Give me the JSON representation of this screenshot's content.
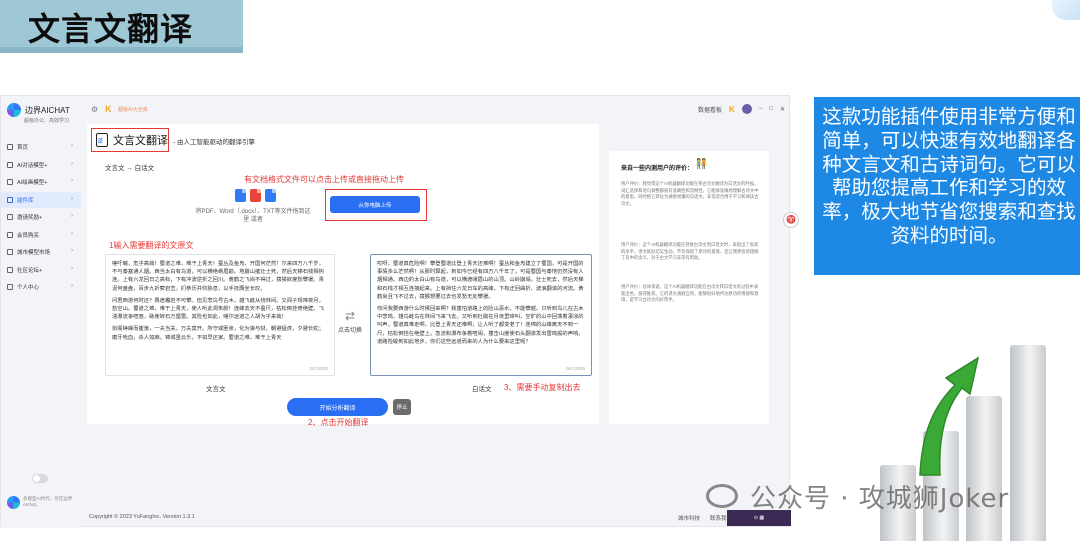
{
  "slide": {
    "title": "文言文翻译",
    "callout": "这款功能插件使用非常方便和简单，可以快速有效地翻译各种文言文和古诗词句。它可以帮助您提高工作和学习的效率，极大地节省您搜索和查找资料的时间。",
    "watermark": "公众号 · 攻城狮Joker"
  },
  "app": {
    "brand_name": "边界AICHAT",
    "brand_sub": "超级办公、高效学习",
    "topbar_brand": "超级AI大全库",
    "topbar_right_link": "数据看板",
    "sidebar": {
      "items": [
        {
          "label": "首页",
          "active": false
        },
        {
          "label": "AI对话模型+",
          "active": false
        },
        {
          "label": "AI绘画模型+",
          "active": false
        },
        {
          "label": "插件库",
          "active": true
        },
        {
          "label": "邀请奖励+",
          "active": false
        },
        {
          "label": "会员购买",
          "active": false
        },
        {
          "label": "城市模型市场",
          "active": false
        },
        {
          "label": "社区论坛+",
          "active": false
        },
        {
          "label": "个人中心",
          "active": false
        }
      ],
      "footer_text": "多模型AI时代，尽在边界AIchat。"
    },
    "module": {
      "title": "文言文翻译",
      "subtitle": "- 由人工智能驱动的翻译引擎",
      "direction": "文言文 → 白话文",
      "upload_hint": "有文档格式文件可以点击上传或直接拖动上传",
      "upload_desc": "将PDF、Word（.docx）、TXT等文件拖到这里 或者",
      "upload_button": "从你电脑上传",
      "input_hint": "1输入需要翻译的文原文",
      "source_paragraphs": [
        "嗟吁嘁，危乎高哉！蜀道之难，难于上青天！蚕丛及鱼凫，开国何茫然！尔来四万八千岁，不与秦塞通人烟。西当太白有鸟道，可以横绝峨眉巅。地崩山摧壮士死，然后天梯石栈相钩连。上有六龙回日之高标，下有冲波逆折之回川。黄鹤之飞尚不得过，猿猱欲度愁攀援。青泥何盘盘，百步九折萦岩峦。扪参历井仰胁息，以手抚膺坐长叹。",
        "问君西游何时还？畏途巉岩不可攀。但见悲鸟号古木，雄飞雌从绕林间。又闻子规啼夜月，愁空山。蜀道之难，难于上青天，使人听此凋朱颜！连峰去天不盈尺，枯松倒挂倚绝壁。飞湍瀑流争喧豗，砯崖转石万壑雷。其险也如此，嗟尔远道之人胡为乎来哉！",
        "剑阁峥嵘而崔嵬，一夫当关，万夫莫开。所守或匪亲，化为狼与豺。朝避猛虎，夕避长蛇；磨牙吮血，杀人如麻。锦城虽云乐，不如早还家。蜀道之难，难于上青天"
      ],
      "source_count": "347/2000",
      "swap_label": "点击切换",
      "target_paragraphs": [
        "哎呀，蜀道真危险啊！攀登蜀道比登上青天还难啊！蚕丛和鱼凫建立了蜀国，可是开国的事情多么茫然啊！从那时算起，到如今已经有四万八千年了，可是蜀国与秦地仍然没有人烟相通。西边的太白山有鸟道，可以横渡峨眉山的山顶。山岭崩塌，壮士死去，然后天梯和石栈才相互连接起来。上有挡住六龙日车的高峰，下有迂回曲折、波浪翻滚的河流。黄鹤尚且飞不过去，猿猴想要过去也发愁无处攀援。",
        "你问我要西游什么时候回来啊？我害怕道路上的险山恶水，不能攀越。只听到鸟儿在古木中悲鸣，雄鸟雌鸟在林间飞来飞去。又听到杜鹃在月夜里啼叫，空旷的山中回荡着凄凉的叫声。蜀道真难走啊，比登上青天还难啊，让人听了都变老了！连绵的山峰离天不到一尺，枯松倒挂在绝壁上。急流和瀑布争着喧闹，撞击山崖使石头翻滚发出雷鸣般的声响。道路险峻到如此地步，你们这些远道而来的人为什么要来这里呢？"
      ],
      "target_count": "567/2000",
      "source_label": "文言文",
      "target_label": "白话文",
      "copy_hint": "3、需要手动复制出去",
      "start_button": "开始分析翻译",
      "stop_button": "停止",
      "start_hint": "2、点击开始翻译"
    },
    "panel": {
      "title": "来自一些内测用户的评价：",
      "reviews": [
        "用户评价：我觉得这个AI机器翻译功能在将古诗文翻译为白话文的时候，词汇选择和语句调整都很有准确性和流畅性，它能够准确地理解古诗文中的意思，同时把它转化为通俗易懂的白话文，非常适合用于学习和阅读古诗文。",
        "用户评价：这个AI机器翻译功能在转换古诗文到白话文时，表现出了很高的水平，译文既贴切又生动，不仅保留了原诗的意境，还让我更容易理解了其中的含义，对于古文学习非常有帮助。",
        "用户评价：总体来说，这个AI机器翻译功能在古诗文转白话文的过程中表现出色，值得推荐。它的译文通顺自然，能够很好地传达原诗的情感和意境，是学习古诗文的好帮手。"
      ]
    },
    "footer": {
      "copyright": "Copyright © 2023 YuFangInc. Version 1.3.1",
      "links": [
        "城市科技",
        "联系我们"
      ]
    }
  }
}
